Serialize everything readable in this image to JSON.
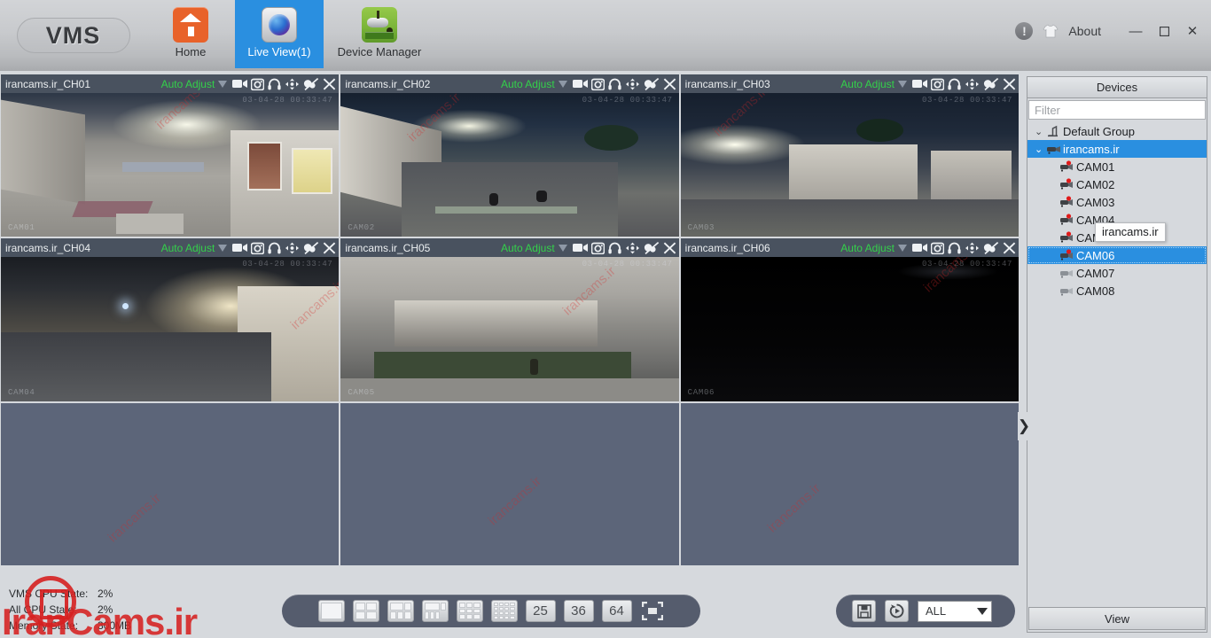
{
  "app": {
    "logo": "VMS",
    "about_label": "About",
    "info_icon": "info-icon",
    "skin_icon": "tshirt-icon",
    "window_controls": {
      "minimize": "—",
      "maximize": "▢",
      "close": "✕"
    },
    "accent_color": "#2a8fe0",
    "panel_color": "#d6d9dd",
    "tile_bar_color": "#49525f",
    "empty_tile_color": "#5c6579",
    "auto_adjust_color": "#33d14a",
    "toolbar_pill_color": "#555c6d"
  },
  "nav": {
    "items": [
      {
        "label": "Home",
        "icon": "home-icon",
        "active": false
      },
      {
        "label": "Live View(1)",
        "icon": "live-view-icon",
        "active": true
      },
      {
        "label": "Device Manager",
        "icon": "device-manager-icon",
        "active": false
      }
    ]
  },
  "tiles": [
    {
      "title": "irancams.ir_CH01",
      "auto": "Auto Adjust",
      "timestamp": "03-04-28 00:33:47",
      "cam": "CAM01",
      "empty": false
    },
    {
      "title": "irancams.ir_CH02",
      "auto": "Auto Adjust",
      "timestamp": "03-04-28 00:33:47",
      "cam": "CAM02",
      "empty": false
    },
    {
      "title": "irancams.ir_CH03",
      "auto": "Auto Adjust",
      "timestamp": "03-04-28 00:33:47",
      "cam": "CAM03",
      "empty": false
    },
    {
      "title": "irancams.ir_CH04",
      "auto": "Auto Adjust",
      "timestamp": "03-04-28 00:33:47",
      "cam": "CAM04",
      "empty": false
    },
    {
      "title": "irancams.ir_CH05",
      "auto": "Auto Adjust",
      "timestamp": "03-04-28 00:33:47",
      "cam": "CAM05",
      "empty": false
    },
    {
      "title": "irancams.ir_CH06",
      "auto": "Auto Adjust",
      "timestamp": "03-04-28 00:33:47",
      "cam": "CAM06",
      "empty": false
    },
    {
      "title": "",
      "auto": "",
      "timestamp": "",
      "cam": "",
      "empty": true
    },
    {
      "title": "",
      "auto": "",
      "timestamp": "",
      "cam": "",
      "empty": true
    },
    {
      "title": "",
      "auto": "",
      "timestamp": "",
      "cam": "",
      "empty": true
    }
  ],
  "tile_toolbar_icons": [
    "video-record-icon",
    "snapshot-icon",
    "audio-headphones-icon",
    "ptz-control-icon",
    "image-color-adjust-icon",
    "close-icon"
  ],
  "status": {
    "rows": [
      {
        "key": "VMS CPU State:",
        "value": "2%"
      },
      {
        "key": "All CPU State:",
        "value": "2%"
      },
      {
        "key": "Memory State:",
        "value": "300MB"
      }
    ]
  },
  "layout_toolbar": {
    "grid_buttons": [
      {
        "name": "layout-1",
        "cells": 1
      },
      {
        "name": "layout-4",
        "cells": 4
      },
      {
        "name": "layout-6",
        "cells": 6
      },
      {
        "name": "layout-8",
        "cells": 8
      },
      {
        "name": "layout-9",
        "cells": 9
      },
      {
        "name": "layout-16",
        "cells": 16
      }
    ],
    "number_buttons": [
      "25",
      "36",
      "64"
    ],
    "fullscreen_icon": "fullscreen-icon"
  },
  "right_toolbar": {
    "save_icon": "save-layout-icon",
    "tour_icon": "tour-cycle-icon",
    "select_value": "ALL"
  },
  "devices": {
    "title": "Devices",
    "filter_placeholder": "Filter",
    "collapse_icon": "collapse-right-icon",
    "tooltip": "irancams.ir",
    "view_label": "View",
    "tree": [
      {
        "label": "Default Group",
        "depth": 0,
        "icon": "group-icon",
        "chevron": "⌄",
        "state": "normal"
      },
      {
        "label": "irancams.ir",
        "depth": 1,
        "icon": "device-icon",
        "chevron": "⌄",
        "state": "selected"
      },
      {
        "label": "CAM01",
        "depth": 2,
        "icon": "camera-online-icon",
        "chevron": "",
        "state": "normal"
      },
      {
        "label": "CAM02",
        "depth": 2,
        "icon": "camera-online-icon",
        "chevron": "",
        "state": "normal"
      },
      {
        "label": "CAM03",
        "depth": 2,
        "icon": "camera-online-icon",
        "chevron": "",
        "state": "normal"
      },
      {
        "label": "CAM04",
        "depth": 2,
        "icon": "camera-online-icon",
        "chevron": "",
        "state": "normal"
      },
      {
        "label": "CAM05",
        "depth": 2,
        "icon": "camera-online-icon",
        "chevron": "",
        "state": "normal"
      },
      {
        "label": "CAM06",
        "depth": 2,
        "icon": "camera-online-icon",
        "chevron": "",
        "state": "selected-focus"
      },
      {
        "label": "CAM07",
        "depth": 2,
        "icon": "camera-offline-icon",
        "chevron": "",
        "state": "normal"
      },
      {
        "label": "CAM08",
        "depth": 2,
        "icon": "camera-offline-icon",
        "chevron": "",
        "state": "normal"
      }
    ]
  },
  "watermark": {
    "text": "irancams.ir",
    "brand": "IranCams.ir",
    "color": "#d62828"
  }
}
